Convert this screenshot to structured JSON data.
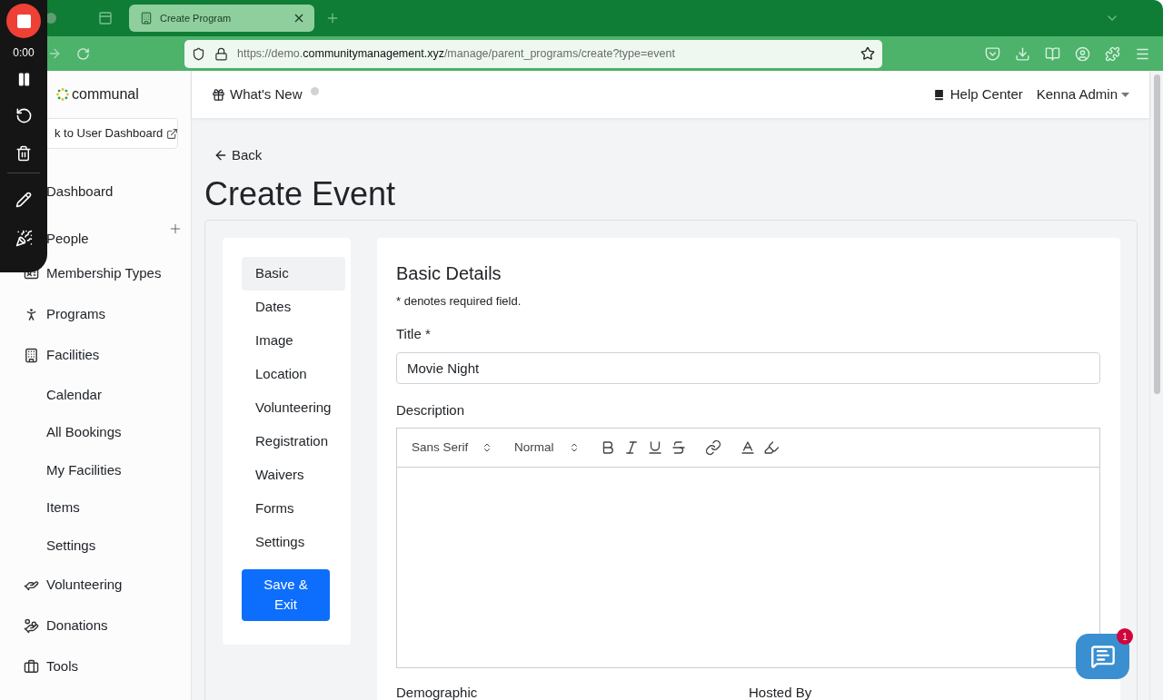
{
  "browser": {
    "tab": {
      "title": "Create Program"
    },
    "url": {
      "scheme": "https://demo.",
      "host": "communitymanagement.xyz",
      "path": "/manage/parent_programs/create?type=event"
    }
  },
  "recorder": {
    "time": "0:00"
  },
  "sidebar": {
    "logo": "communal",
    "back_button": "k to User Dashboard",
    "items": [
      {
        "label": "Dashboard",
        "addable": false
      },
      {
        "label": "People",
        "addable": true
      },
      {
        "label": "Membership Types",
        "addable": false
      },
      {
        "label": "Programs",
        "addable": false
      },
      {
        "label": "Facilities",
        "addable": false,
        "children": [
          {
            "label": "Calendar"
          },
          {
            "label": "All Bookings"
          },
          {
            "label": "My Facilities"
          },
          {
            "label": "Items"
          },
          {
            "label": "Settings"
          }
        ]
      },
      {
        "label": "Volunteering",
        "addable": false
      },
      {
        "label": "Donations",
        "addable": false
      },
      {
        "label": "Tools",
        "addable": false
      }
    ]
  },
  "header": {
    "whats_new": "What's New",
    "help": "Help Center",
    "user": "Kenna Admin"
  },
  "page": {
    "back": "Back",
    "title": "Create Event"
  },
  "steps": [
    {
      "label": "Basic",
      "selected": true
    },
    {
      "label": "Dates",
      "selected": false
    },
    {
      "label": "Image",
      "selected": false
    },
    {
      "label": "Location",
      "selected": false
    },
    {
      "label": "Volunteering",
      "selected": false
    },
    {
      "label": "Registration",
      "selected": false
    },
    {
      "label": "Waivers",
      "selected": false
    },
    {
      "label": "Forms",
      "selected": false
    },
    {
      "label": "Settings",
      "selected": false
    }
  ],
  "save_button": "Save & Exit",
  "form": {
    "heading": "Basic Details",
    "note": "* denotes required field.",
    "title_label": "Title *",
    "title_value": "Movie Night",
    "description_label": "Description",
    "editor": {
      "font": "Sans Serif",
      "size": "Normal"
    },
    "next_labels": [
      "Demographic",
      "Hosted By"
    ]
  },
  "chat": {
    "badge": "1"
  }
}
